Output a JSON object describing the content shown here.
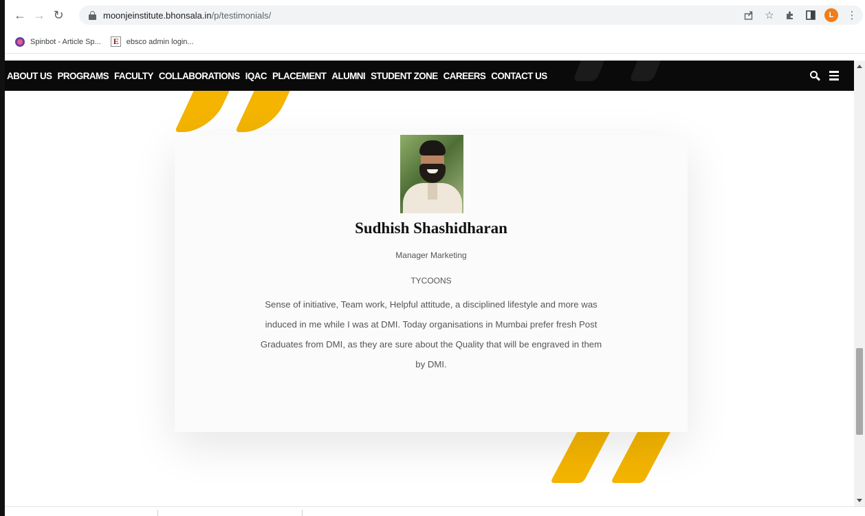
{
  "browser": {
    "url_host": "moonjeinstitute.bhonsala.in",
    "url_path": "/p/testimonials/",
    "profile_initial": "L"
  },
  "bookmarks": [
    {
      "label": "Spinbot - Article Sp..."
    },
    {
      "label": "ebsco admin login..."
    }
  ],
  "site_nav": {
    "items": [
      "ABOUT US",
      "PROGRAMS",
      "FACULTY",
      "COLLABORATIONS",
      "IQAC",
      "PLACEMENT",
      "ALUMNI",
      "STUDENT ZONE",
      "CAREERS",
      "CONTACT US"
    ]
  },
  "testimonial": {
    "name": "Sudhish Shashidharan",
    "role": "Manager Marketing",
    "company": "TYCOONS",
    "quote": "Sense of initiative, Team work, Helpful attitude, a disciplined lifestyle and more was induced in me while I was at DMI. Today organisations in Mumbai prefer fresh Post Graduates from DMI, as they are sure about the Quality that will be engraved in them by DMI."
  },
  "colors": {
    "accent": "#f4b400",
    "nav_bg": "#0a0a0a"
  }
}
